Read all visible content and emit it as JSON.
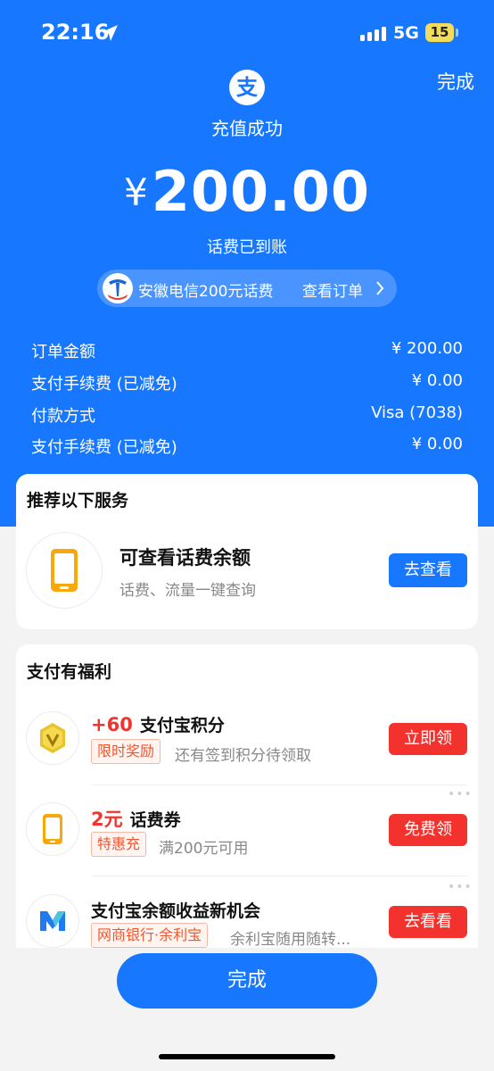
{
  "status_bar": {
    "time": "22:16",
    "network": "5G",
    "battery": "15"
  },
  "header": {
    "done_label": "完成",
    "logo_char": "支",
    "title": "充值成功",
    "currency": "¥",
    "amount": "200.00",
    "subtitle": "话费已到账"
  },
  "order_pill": {
    "text": "安徽电信200元话费",
    "link": "查看订单"
  },
  "details": [
    {
      "label": "订单金额",
      "value": "¥ 200.00"
    },
    {
      "label": "支付手续费 (已减免)",
      "value": "¥ 0.00"
    },
    {
      "label": "付款方式",
      "value": "Visa (7038)"
    },
    {
      "label": "支付手续费 (已减免)",
      "value": "¥ 0.00"
    }
  ],
  "recommend": {
    "title": "推荐以下服务",
    "item_title": "可查看话费余额",
    "item_desc": "话费、流量一键查询",
    "button": "去查看"
  },
  "benefits": {
    "title": "支付有福利",
    "items": [
      {
        "highlight": "+60",
        "title": "支付宝积分",
        "tag": "限时奖励",
        "desc": "还有签到积分待领取",
        "button": "立即领"
      },
      {
        "highlight": "2元",
        "title": "话费券",
        "tag": "特惠充",
        "desc": "满200元可用",
        "button": "免费领"
      },
      {
        "highlight": "",
        "title": "支付宝余额收益新机会",
        "tag": "网商银行·余利宝",
        "desc": "余利宝随用随转...",
        "button": "去看看"
      }
    ]
  },
  "bottom_done": "完成",
  "colors": {
    "primary": "#1777ff",
    "danger": "#f3322e",
    "accent_orange": "#f7a90c"
  }
}
